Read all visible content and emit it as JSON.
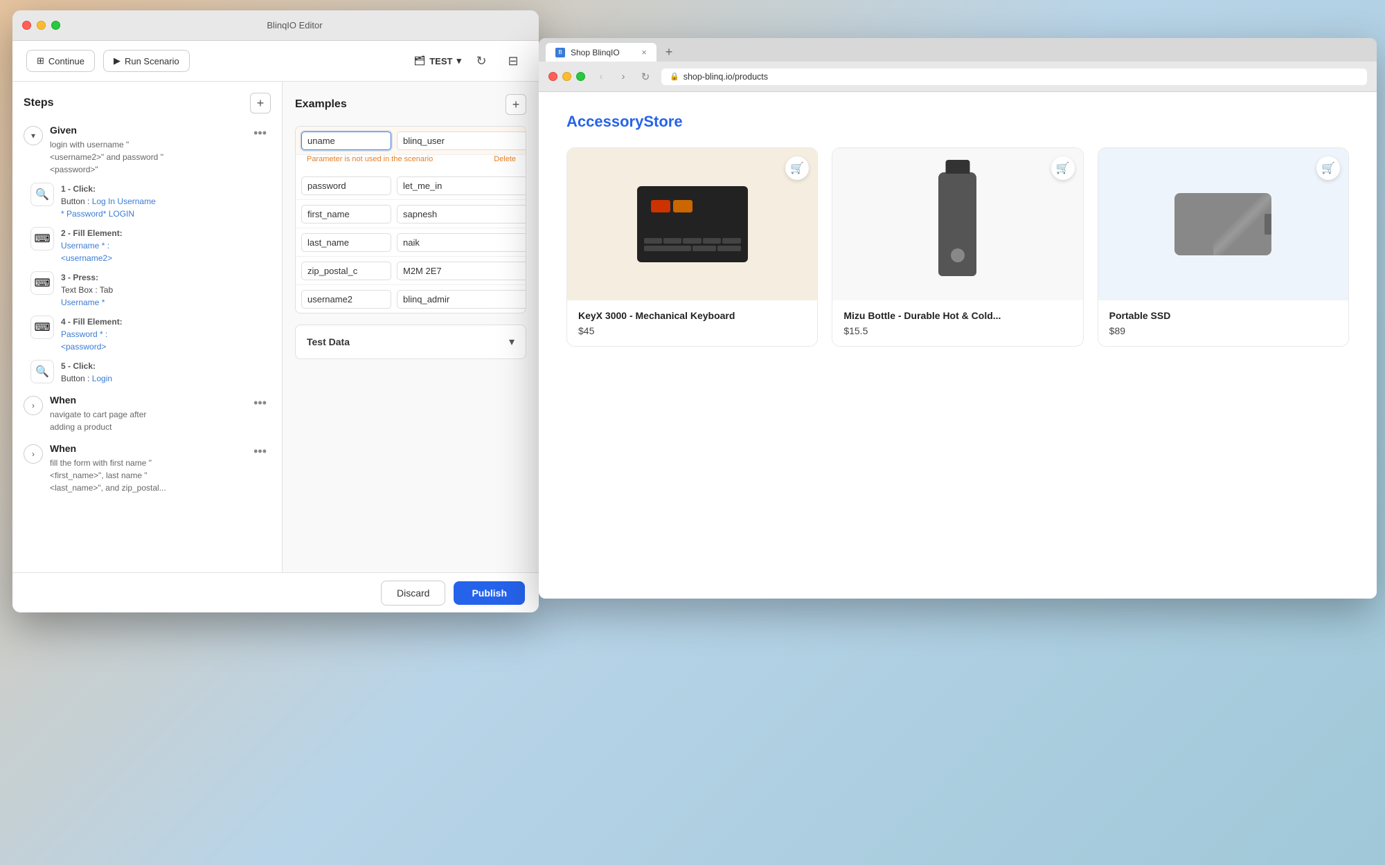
{
  "editor": {
    "window_title": "BlinqIO Editor",
    "toolbar": {
      "continue_label": "Continue",
      "run_scenario_label": "Run Scenario",
      "project_name": "TEST",
      "continue_icon": "⊞",
      "run_icon": "▶",
      "folder_icon": "🗂",
      "refresh_icon": "↻",
      "layout_icon": "⊟"
    },
    "steps": {
      "title": "Steps",
      "add_icon": "+",
      "groups": [
        {
          "id": "given",
          "label": "Given",
          "description": "login with username \"<username2>\" and password \"<password>\"",
          "expanded": true,
          "items": [
            {
              "num": "1 - Click:",
              "detail": "Button : Log In Username * Password* LOGIN",
              "icon": "🔍",
              "type": "click"
            },
            {
              "num": "2 - Fill Element:",
              "detail": "Username * : <username2>",
              "icon": "⌨",
              "type": "fill"
            },
            {
              "num": "3 - Press:",
              "detail": "Text Box : Tab Username *",
              "icon": "⌨",
              "type": "press"
            },
            {
              "num": "4 - Fill Element:",
              "detail": "Password * : <password>",
              "icon": "⌨",
              "type": "fill"
            },
            {
              "num": "5 - Click:",
              "detail": "Button : Login",
              "icon": "🔍",
              "type": "click"
            }
          ]
        },
        {
          "id": "when1",
          "label": "When",
          "description": "navigate to cart page after adding a product",
          "expanded": false
        },
        {
          "id": "when2",
          "label": "When",
          "description": "fill the form with first name \"<first_name>\", last name \"<last_name>\", and zip postal...",
          "expanded": false
        }
      ]
    },
    "examples": {
      "title": "Examples",
      "add_icon": "+",
      "error_text": "Parameter is not used in the scenario",
      "delete_label": "Delete",
      "rows": [
        {
          "key": "uname",
          "value": "blinq_user",
          "highlighted": true,
          "error": true
        },
        {
          "key": "password",
          "value": "let_me_in",
          "highlighted": false
        },
        {
          "key": "first_name",
          "value": "sapnesh",
          "highlighted": false
        },
        {
          "key": "last_name",
          "value": "naik",
          "highlighted": false
        },
        {
          "key": "zip_postal_c",
          "value": "M2M 2E7",
          "highlighted": false
        },
        {
          "key": "username2",
          "value": "blinq_admir",
          "highlighted": false
        }
      ]
    },
    "test_data": {
      "title": "Test Data",
      "expanded": false
    },
    "bottom_bar": {
      "discard_label": "Discard",
      "publish_label": "Publish"
    }
  },
  "browser": {
    "window_title": "Shop BlinqIO",
    "url": "shop-blinq.io/products",
    "tab_label": "Shop BlinqIO",
    "store_name": "Accessory",
    "store_name_brand": "Store",
    "products": [
      {
        "name": "KeyX 3000 - Mechanical Keyboard",
        "price": "$45",
        "bg": "cream",
        "type": "keyboard"
      },
      {
        "name": "Mizu Bottle - Durable Hot & Cold...",
        "price": "$15.5",
        "bg": "white",
        "type": "bottle"
      },
      {
        "name": "Portable SSD",
        "price": "$89",
        "bg": "light-blue",
        "type": "ssd"
      }
    ]
  },
  "icons": {
    "chevron_down": "▾",
    "chevron_right": "›",
    "chevron_up": "▴",
    "plus": "+",
    "dots": "•••",
    "trash": "🗑",
    "back": "‹",
    "forward": "›",
    "refresh": "↻",
    "lock": "🔒",
    "cart": "🛒",
    "close": "×"
  }
}
